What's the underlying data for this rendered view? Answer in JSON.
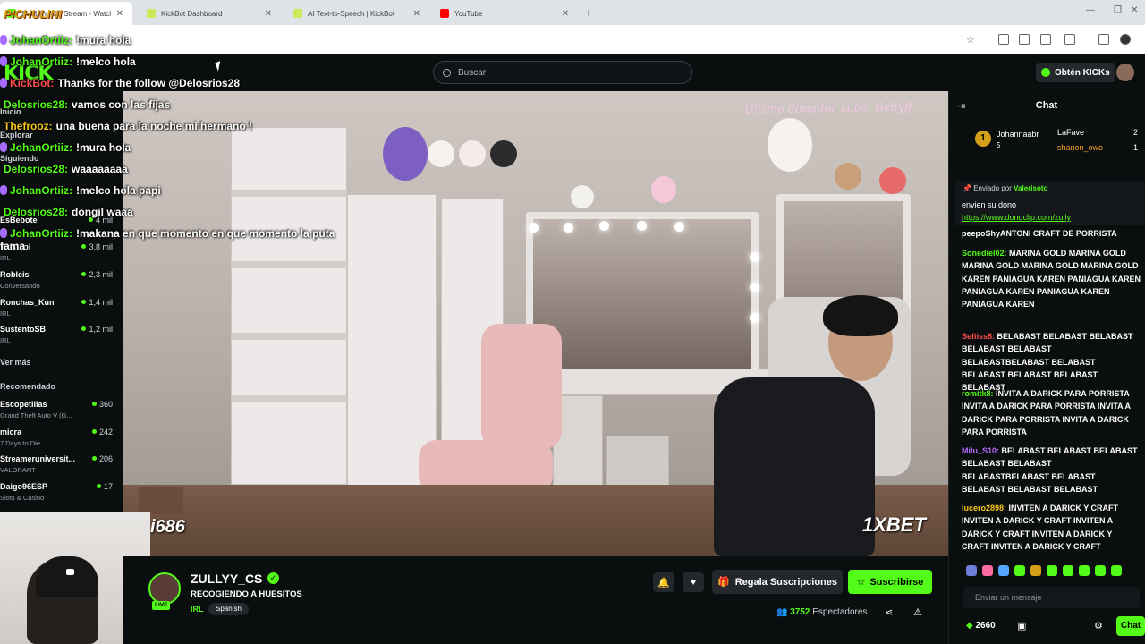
{
  "browser": {
    "tabs": [
      {
        "title": "ZULLYY_CS Stream - Watch Live",
        "color": "#53fc18"
      },
      {
        "title": "KickBot Dashboard",
        "color": "#53fc18"
      },
      {
        "title": "AI Text-to-Speech | KickBot",
        "color": "#53fc18"
      },
      {
        "title": "YouTube",
        "color": "#ff0000"
      }
    ],
    "new_tab": "+",
    "close_glyph": "✕"
  },
  "overlay": {
    "brand": "PICHULINI",
    "lines": [
      {
        "user": "JohanOrtiiz:",
        "color": "#53fc18",
        "text": "!mura hola"
      },
      {
        "user": "JohanOrtiiz:",
        "color": "#53fc18",
        "text": "!melco hola"
      },
      {
        "user": "KickBot:",
        "color": "#ff4d4d",
        "text": "Thanks for the follow @Delosrios28"
      },
      {
        "user": "Delosrios28:",
        "color": "#53fc18",
        "text": "vamos con las fijas"
      },
      {
        "user": "Thefrooz:",
        "color": "#f5c518",
        "text": "una buena para la noche mi hermano !"
      },
      {
        "user": "JohanOrtiiz:",
        "color": "#53fc18",
        "text": "!mura hola"
      },
      {
        "user": "Delosrios28:",
        "color": "#53fc18",
        "text": "waaaaaaaa"
      },
      {
        "user": "JohanOrtiiz:",
        "color": "#53fc18",
        "text": "!melco hola papi"
      },
      {
        "user": "Delosrios28:",
        "color": "#53fc18",
        "text": "dongil waaa"
      },
      {
        "user": "JohanOrtiiz:",
        "color": "#53fc18",
        "text": "!makana en que momento en que momento la puta fama"
      }
    ]
  },
  "kick": {
    "logo": "KICK",
    "search_placeholder": "Buscar",
    "get_kicks": "Obtén KICKs"
  },
  "sidebar": {
    "labels": [
      "Inicio",
      "Explorar",
      "Siguiendo",
      "Ver más",
      "Recomendado"
    ],
    "following": [
      {
        "name": "EsBebote",
        "category": "",
        "viewers": "4 mil"
      },
      {
        "name": "Westcol",
        "category": "IRL",
        "viewers": "3,8 mil"
      },
      {
        "name": "Robleis",
        "category": "Conversando",
        "viewers": "2,3 mil"
      },
      {
        "name": "Ronchas_Kun",
        "category": "IRL",
        "viewers": "1,4 mil"
      },
      {
        "name": "SustentoSB",
        "category": "IRL",
        "viewers": "1,2 mil"
      }
    ],
    "recommended": [
      {
        "name": "Escopetillas",
        "category": "Grand Theft Auto V (G...",
        "viewers": "360"
      },
      {
        "name": "micra",
        "category": "7 Days to Die",
        "viewers": "242"
      },
      {
        "name": "Streameruniversit...",
        "category": "VALORANT",
        "viewers": "206"
      },
      {
        "name": "Daigo96ESP",
        "category": "Slots & Casino",
        "viewers": "17"
      }
    ]
  },
  "webcam": {
    "tag": "i686"
  },
  "video": {
    "donor_text": "Último donador subs: Bebyff",
    "sponsor": "1XBET"
  },
  "stream": {
    "channel": "ZULLYY_CS",
    "title": "RECOGIENDO A HUESITOS",
    "category": "IRL",
    "tag": "Spanish",
    "live": "LIVE",
    "gift_label": "Regala Suscripciones",
    "subscribe_label": "Suscribirse",
    "viewers_count": "3752",
    "viewers_label": "Espectadores"
  },
  "chat": {
    "title": "Chat",
    "leaderboard": [
      {
        "name": "Johannaabr",
        "score": "5"
      },
      {
        "name": "LaFave",
        "score": "2"
      },
      {
        "name": "shanon_owo",
        "score": "1"
      }
    ],
    "pinned_by_label": "Enviado por",
    "pinned_by_user": "Valerisoto",
    "pinned_text": "envien su dono",
    "pinned_link": "https://www.donoclip.com/zully",
    "messages": [
      {
        "user": "",
        "color": "#fff",
        "text": "peepoShyANTONI CRAFT DE PORRISTA"
      },
      {
        "user": "Sonediel02:",
        "color": "#53fc18",
        "text": "MARINA GOLD MARINA GOLD MARINA GOLD MARINA GOLD MARINA GOLD KAREN PANIAGUA KAREN PANIAGUA KAREN PANIAGUA KAREN PANIAGUA KAREN PANIAGUA KAREN"
      },
      {
        "user": "Sefiiss8:",
        "color": "#ff4d4d",
        "text": "BELABAST BELABAST BELABAST BELABAST BELABAST BELABASTBELABAST BELABAST BELABAST BELABAST BELABAST BELABAST"
      },
      {
        "user": "romitk8:",
        "color": "#53fc18",
        "text": "INVITA A DARICK PARA PORRISTA INVITA A DARICK PARA PORRISTA INVITA A DARICK PARA PORRISTA INVITA A DARICK PARA PORRISTA"
      },
      {
        "user": "Milu_S10:",
        "color": "#b56cff",
        "text": "BELABAST BELABAST BELABAST BELABAST BELABAST BELABASTBELABAST BELABAST BELABAST BELABAST BELABAST"
      },
      {
        "user": "lucero2898:",
        "color": "#f5c518",
        "text": "INVITEN A DARICK Y CRAFT INVITEN A DARICK Y CRAFT INVITEN A DARICK Y CRAFT INVITEN A DARICK Y CRAFT INVITEN A DARICK Y CRAFT"
      }
    ],
    "input_placeholder": "Enviar un mensaje",
    "kicks_balance": "2660",
    "send_label": "Chat"
  }
}
